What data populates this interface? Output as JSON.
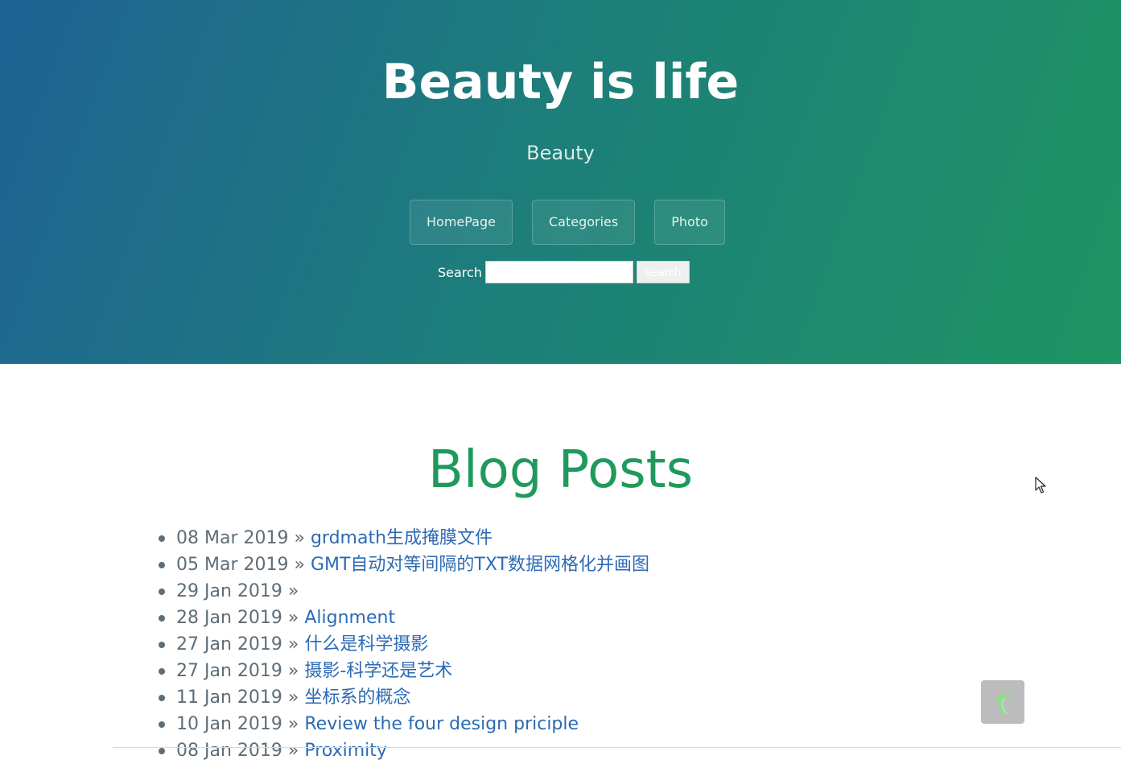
{
  "header": {
    "title": "Beauty is life",
    "tagline": "Beauty"
  },
  "nav": {
    "items": [
      {
        "label": "HomePage"
      },
      {
        "label": "Categories"
      },
      {
        "label": "Photo"
      }
    ]
  },
  "search": {
    "label": "Search",
    "value": "",
    "button_label": "search"
  },
  "main": {
    "title": "Blog Posts",
    "posts": [
      {
        "date": "08 Mar 2019",
        "title": "grdmath生成掩膜文件"
      },
      {
        "date": "05 Mar 2019",
        "title": "GMT自动对等间隔的TXT数据网格化并画图"
      },
      {
        "date": "29 Jan 2019",
        "title": ""
      },
      {
        "date": "28 Jan 2019",
        "title": "Alignment"
      },
      {
        "date": "27 Jan 2019",
        "title": "什么是科学摄影"
      },
      {
        "date": "27 Jan 2019",
        "title": "摄影-科学还是艺术"
      },
      {
        "date": "11 Jan 2019",
        "title": "坐标系的概念"
      },
      {
        "date": "10 Jan 2019",
        "title": "Review the four design priciple"
      },
      {
        "date": "08 Jan 2019",
        "title": "Proximity"
      }
    ],
    "separator": "»"
  },
  "colors": {
    "hero_start": "#1e6394",
    "hero_end": "#1e9563",
    "heading_green": "#1f9a5c",
    "link_blue": "#2c6ab3",
    "text_gray": "#5e6d77"
  },
  "icons": {
    "back_to_top": "back-to-top-arrow-icon",
    "cursor": "mouse-pointer-icon"
  }
}
